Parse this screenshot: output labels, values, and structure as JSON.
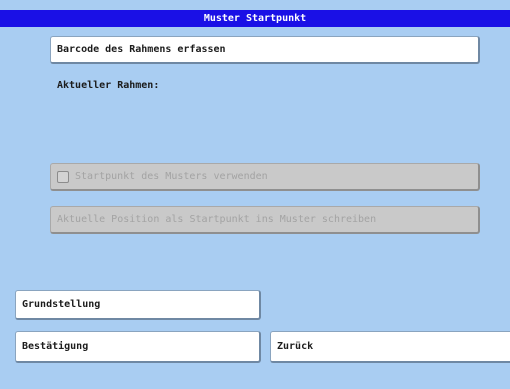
{
  "window": {
    "title": "Muster Startpunkt"
  },
  "frame": {
    "capture_barcode_label": "Barcode des Rahmens erfassen",
    "current_frame_label": "Aktueller Rahmen:"
  },
  "options": {
    "use_pattern_start_label": "Startpunkt des Musters verwenden",
    "use_pattern_start_checked": false,
    "use_pattern_start_enabled": false,
    "write_position_label": "Aktuelle Position als Startpunkt ins Muster schreiben",
    "write_position_enabled": false
  },
  "footer": {
    "home_label": "Grundstellung",
    "confirm_label": "Bestätigung",
    "back_label": "Zurück"
  },
  "colors": {
    "title_bar": "#1a10e6",
    "background": "#a9cdf2",
    "button": "#ffffff",
    "disabled_button": "#c9c9c9"
  }
}
